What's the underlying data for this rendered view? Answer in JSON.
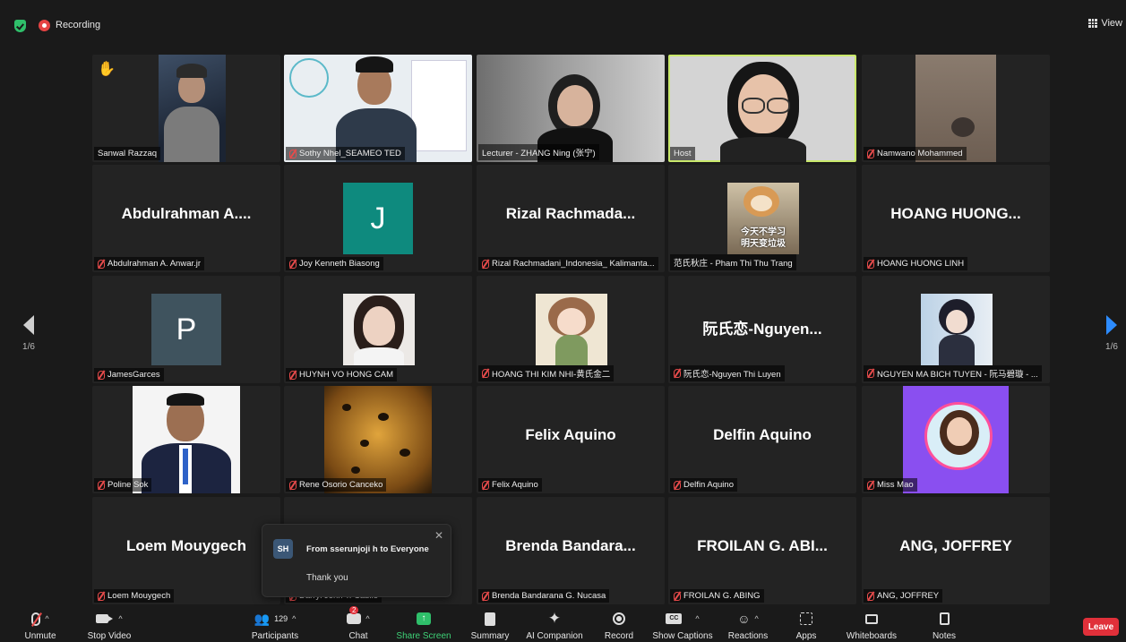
{
  "topbar": {
    "recording_label": "Recording",
    "view_label": "View"
  },
  "pager": {
    "left_page": "1/6",
    "right_page": "1/6"
  },
  "tiles": [
    {
      "name": "Sanwal Razzaq"
    },
    {
      "name": "Sothy Nhel_SEAMEO TED"
    },
    {
      "name": "Lecturer - ZHANG Ning (张宁)"
    },
    {
      "name": "Host"
    },
    {
      "name": "Namwano Mohammed"
    },
    {
      "display": "Abdulrahman A....",
      "name": "Abdulrahman A. Anwar.jr"
    },
    {
      "initial": "J",
      "name": "Joy Kenneth Biasong"
    },
    {
      "display": "Rizal Rachmada...",
      "name": "Rizal Rachmadani_Indonesia_ Kalimanta..."
    },
    {
      "name": "范氏秋庄 - Pham Thi Thu Trang",
      "caption1": "今天不学习",
      "caption2": "明天变垃圾"
    },
    {
      "display": "HOANG HUONG...",
      "name": "HOANG HUONG LINH"
    },
    {
      "initial": "P",
      "name": "JamesGarces"
    },
    {
      "name": "HUYNH VO HONG CAM"
    },
    {
      "name": "HOANG THI KIM NHI-黄氏金二"
    },
    {
      "display": "阮氏恋-Nguyen...",
      "name": "阮氏恋-Nguyen Thi Luyen"
    },
    {
      "name": "NGUYEN MA BICH TUYEN - 阮马碧璇 - ..."
    },
    {
      "name": "Poline Sok"
    },
    {
      "name": "Rene Osorio Canceko"
    },
    {
      "display": "Felix Aquino",
      "name": "Felix Aquino"
    },
    {
      "display": "Delfin Aquino",
      "name": "Delfin Aquino"
    },
    {
      "name": "Miss Mao"
    },
    {
      "display": "Loem Mouygech",
      "name": "Loem Mouygech"
    },
    {
      "name": "Darryl John T. Cabile"
    },
    {
      "display": "Brenda Bandara...",
      "name": "Brenda Bandarana G. Nucasa"
    },
    {
      "display": "FROILAN G. ABI...",
      "name": "FROILAN G. ABING"
    },
    {
      "display": "ANG, JOFFREY",
      "name": "ANG, JOFFREY"
    }
  ],
  "chat_popup": {
    "avatar": "SH",
    "from": "From sserunjoji h to Everyone",
    "message": "Thank you"
  },
  "toolbar": {
    "unmute": "Unmute",
    "stop_video": "Stop Video",
    "participants": "Participants",
    "participants_count": "129",
    "chat": "Chat",
    "chat_badge": "2",
    "share_screen": "Share Screen",
    "summary": "Summary",
    "ai_companion": "AI Companion",
    "record": "Record",
    "show_captions": "Show Captions",
    "reactions": "Reactions",
    "apps": "Apps",
    "whiteboards": "Whiteboards",
    "notes": "Notes",
    "leave": "Leave"
  },
  "colors": {
    "accent_green": "#3ed277",
    "leave_red": "#e0303a",
    "active_speaker": "#c9e86b",
    "pager_blue": "#2d8cff"
  }
}
